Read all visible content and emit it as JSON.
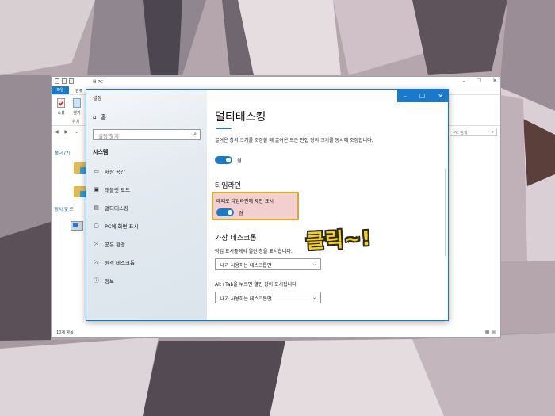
{
  "explorer": {
    "title": "내 PC",
    "file_tab": "파일",
    "tab2": "컴퓨",
    "ribbon_buttons": [
      "속성",
      "열기"
    ],
    "ribbon_group": "위치",
    "search_placeholder": "PC 검색",
    "tree_folders": "폴더 (7)",
    "tree_devices": "장치 및 드",
    "status": "10개 항목"
  },
  "settings": {
    "window_title": "설정",
    "sidebar": {
      "home": "홈",
      "search_placeholder": "설정 찾기",
      "section": "시스템",
      "items": [
        {
          "label": "저장 공간",
          "icon": "storage-icon"
        },
        {
          "label": "태블릿 모드",
          "icon": "tablet-icon"
        },
        {
          "label": "멀티태스킹",
          "icon": "multitasking-icon"
        },
        {
          "label": "PC에 화면 표시",
          "icon": "project-icon"
        },
        {
          "label": "공유 환경",
          "icon": "shared-experiences-icon"
        },
        {
          "label": "원격 데스크톱",
          "icon": "remote-desktop-icon"
        },
        {
          "label": "정보",
          "icon": "info-icon"
        }
      ]
    },
    "content": {
      "page_title": "멀티태스킹",
      "snap_desc": "끌어온 창의 크기를 조정할 때 끌어온 모든 인접 창의 크기를 동시에 조정합니다.",
      "snap_toggle_state": "켬",
      "timeline_heading": "타임라인",
      "timeline_suggestion_label": "때때로 타임라인에 제안 표시",
      "timeline_toggle_state": "켬",
      "virtual_desktop_heading": "가상 데스크톱",
      "taskbar_label": "작업 표시줄에서 열린 창을 표시합니다.",
      "taskbar_value": "내가 사용하는 데스크톱만",
      "alttab_label": "Alt+Tab을 누르면 열린 창이 표시됩니다.",
      "alttab_value": "내가 사용하는 데스크톱만"
    },
    "window_controls": [
      "–",
      "☐",
      "✕"
    ]
  },
  "annotation": "클릭~!",
  "colors": {
    "accent": "#1979ca",
    "highlight_fill": "#f3cfd0",
    "highlight_border": "#e0a82a",
    "callout": "#f6d01c"
  }
}
